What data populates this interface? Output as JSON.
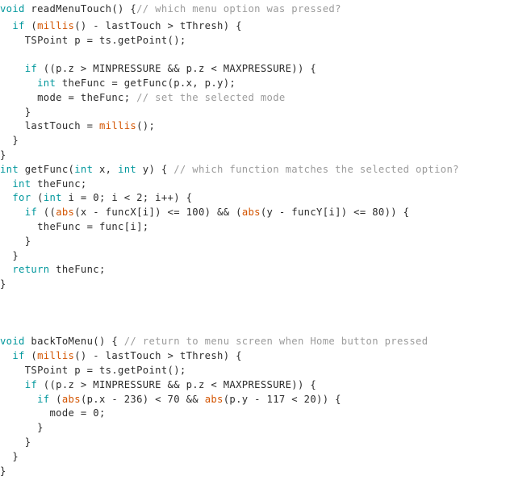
{
  "document": {
    "kind": "source-code-listing",
    "language": "arduino-c",
    "background_color": "#ffffff",
    "palette": {
      "keyword": "#00979c",
      "builtin_function": "#d35400",
      "comment": "#9b9b9b",
      "plain_text": "#2b2b2b"
    }
  },
  "lines": [
    {
      "index": 0,
      "text": "void readMenuTouch() {// which menu option was pressed?",
      "tokens": [
        {
          "t": "void",
          "c": "kw"
        },
        {
          "t": " readMenuTouch() {",
          "c": "plain"
        },
        {
          "t": "// which menu option was pressed?",
          "c": "comment"
        }
      ]
    },
    {
      "index": 1,
      "text": "  if (millis() - lastTouch > tThresh) {",
      "tokens": [
        {
          "t": "  ",
          "c": "plain"
        },
        {
          "t": "if",
          "c": "kw"
        },
        {
          "t": " (",
          "c": "plain"
        },
        {
          "t": "millis",
          "c": "fn"
        },
        {
          "t": "() - lastTouch > tThresh) {",
          "c": "plain"
        }
      ]
    },
    {
      "index": 2,
      "text": "    TSPoint p = ts.getPoint();",
      "tokens": [
        {
          "t": "    TSPoint p = ts.getPoint();",
          "c": "plain"
        }
      ]
    },
    {
      "index": 3,
      "text": "",
      "tokens": []
    },
    {
      "index": 4,
      "text": "    if ((p.z > MINPRESSURE && p.z < MAXPRESSURE)) {",
      "tokens": [
        {
          "t": "    ",
          "c": "plain"
        },
        {
          "t": "if",
          "c": "kw"
        },
        {
          "t": " ((p.z > MINPRESSURE && p.z < MAXPRESSURE)) {",
          "c": "plain"
        }
      ]
    },
    {
      "index": 5,
      "text": "      int theFunc = getFunc(p.x, p.y);",
      "tokens": [
        {
          "t": "      ",
          "c": "plain"
        },
        {
          "t": "int",
          "c": "kw"
        },
        {
          "t": " theFunc = getFunc(p.x, p.y);",
          "c": "plain"
        }
      ]
    },
    {
      "index": 6,
      "text": "      mode = theFunc; // set the selected mode",
      "tokens": [
        {
          "t": "      mode = theFunc; ",
          "c": "plain"
        },
        {
          "t": "// set the selected mode",
          "c": "comment"
        }
      ]
    },
    {
      "index": 7,
      "text": "    }",
      "tokens": [
        {
          "t": "    }",
          "c": "plain"
        }
      ]
    },
    {
      "index": 8,
      "text": "    lastTouch = millis();",
      "tokens": [
        {
          "t": "    lastTouch = ",
          "c": "plain"
        },
        {
          "t": "millis",
          "c": "fn"
        },
        {
          "t": "();",
          "c": "plain"
        }
      ]
    },
    {
      "index": 9,
      "text": "  }",
      "tokens": [
        {
          "t": "  }",
          "c": "plain"
        }
      ]
    },
    {
      "index": 10,
      "text": "}",
      "tokens": [
        {
          "t": "}",
          "c": "plain"
        }
      ]
    },
    {
      "index": 11,
      "text": "int getFunc(int x, int y) { // which function matches the selected option?",
      "tokens": [
        {
          "t": "int",
          "c": "kw"
        },
        {
          "t": " getFunc(",
          "c": "plain"
        },
        {
          "t": "int",
          "c": "kw"
        },
        {
          "t": " x, ",
          "c": "plain"
        },
        {
          "t": "int",
          "c": "kw"
        },
        {
          "t": " y) { ",
          "c": "plain"
        },
        {
          "t": "// which function matches the selected option?",
          "c": "comment"
        }
      ]
    },
    {
      "index": 12,
      "text": "  int theFunc;",
      "tokens": [
        {
          "t": "  ",
          "c": "plain"
        },
        {
          "t": "int",
          "c": "kw"
        },
        {
          "t": " theFunc;",
          "c": "plain"
        }
      ]
    },
    {
      "index": 13,
      "text": "  for (int i = 0; i < 2; i++) {",
      "tokens": [
        {
          "t": "  ",
          "c": "plain"
        },
        {
          "t": "for",
          "c": "kw"
        },
        {
          "t": " (",
          "c": "plain"
        },
        {
          "t": "int",
          "c": "kw"
        },
        {
          "t": " i = 0; i < 2; i++) {",
          "c": "plain"
        }
      ]
    },
    {
      "index": 14,
      "text": "    if ((abs(x - funcX[i]) <= 100) && (abs(y - funcY[i]) <= 80)) {",
      "tokens": [
        {
          "t": "    ",
          "c": "plain"
        },
        {
          "t": "if",
          "c": "kw"
        },
        {
          "t": " ((",
          "c": "plain"
        },
        {
          "t": "abs",
          "c": "fn"
        },
        {
          "t": "(x - funcX[i]) <= 100) && (",
          "c": "plain"
        },
        {
          "t": "abs",
          "c": "fn"
        },
        {
          "t": "(y - funcY[i]) <= 80)) {",
          "c": "plain"
        }
      ]
    },
    {
      "index": 15,
      "text": "      theFunc = func[i];",
      "tokens": [
        {
          "t": "      theFunc = func[i];",
          "c": "plain"
        }
      ]
    },
    {
      "index": 16,
      "text": "    }",
      "tokens": [
        {
          "t": "    }",
          "c": "plain"
        }
      ]
    },
    {
      "index": 17,
      "text": "  }",
      "tokens": [
        {
          "t": "  }",
          "c": "plain"
        }
      ]
    },
    {
      "index": 18,
      "text": "  return theFunc;",
      "tokens": [
        {
          "t": "  ",
          "c": "plain"
        },
        {
          "t": "return",
          "c": "kw"
        },
        {
          "t": " theFunc;",
          "c": "plain"
        }
      ]
    },
    {
      "index": 19,
      "text": "}",
      "tokens": [
        {
          "t": "}",
          "c": "plain"
        }
      ]
    },
    {
      "index": 20,
      "text": "",
      "tokens": []
    },
    {
      "index": 21,
      "text": "",
      "tokens": []
    },
    {
      "index": 22,
      "text": "",
      "tokens": []
    },
    {
      "index": 23,
      "text": "void backToMenu() { // return to menu screen when Home button pressed",
      "tokens": [
        {
          "t": "void",
          "c": "kw"
        },
        {
          "t": " backToMenu() { ",
          "c": "plain"
        },
        {
          "t": "// return to menu screen when Home button pressed",
          "c": "comment"
        }
      ]
    },
    {
      "index": 24,
      "text": "  if (millis() - lastTouch > tThresh) {",
      "tokens": [
        {
          "t": "  ",
          "c": "plain"
        },
        {
          "t": "if",
          "c": "kw"
        },
        {
          "t": " (",
          "c": "plain"
        },
        {
          "t": "millis",
          "c": "fn"
        },
        {
          "t": "() - lastTouch > tThresh) {",
          "c": "plain"
        }
      ]
    },
    {
      "index": 25,
      "text": "    TSPoint p = ts.getPoint();",
      "tokens": [
        {
          "t": "    TSPoint p = ts.getPoint();",
          "c": "plain"
        }
      ]
    },
    {
      "index": 26,
      "text": "    if ((p.z > MINPRESSURE && p.z < MAXPRESSURE)) {",
      "tokens": [
        {
          "t": "    ",
          "c": "plain"
        },
        {
          "t": "if",
          "c": "kw"
        },
        {
          "t": " ((p.z > MINPRESSURE && p.z < MAXPRESSURE)) {",
          "c": "plain"
        }
      ]
    },
    {
      "index": 27,
      "text": "      if (abs(p.x - 236) < 70 && abs(p.y - 117 < 20)) {",
      "tokens": [
        {
          "t": "      ",
          "c": "plain"
        },
        {
          "t": "if",
          "c": "kw"
        },
        {
          "t": " (",
          "c": "plain"
        },
        {
          "t": "abs",
          "c": "fn"
        },
        {
          "t": "(p.x - 236) < 70 && ",
          "c": "plain"
        },
        {
          "t": "abs",
          "c": "fn"
        },
        {
          "t": "(p.y - 117 < 20)) {",
          "c": "plain"
        }
      ]
    },
    {
      "index": 28,
      "text": "        mode = 0;",
      "tokens": [
        {
          "t": "        mode = 0;",
          "c": "plain"
        }
      ]
    },
    {
      "index": 29,
      "text": "      }",
      "tokens": [
        {
          "t": "      }",
          "c": "plain"
        }
      ]
    },
    {
      "index": 30,
      "text": "    }",
      "tokens": [
        {
          "t": "    }",
          "c": "plain"
        }
      ]
    },
    {
      "index": 31,
      "text": "  }",
      "tokens": [
        {
          "t": "  }",
          "c": "plain"
        }
      ]
    },
    {
      "index": 32,
      "text": "}",
      "tokens": [
        {
          "t": "}",
          "c": "plain"
        }
      ]
    }
  ]
}
